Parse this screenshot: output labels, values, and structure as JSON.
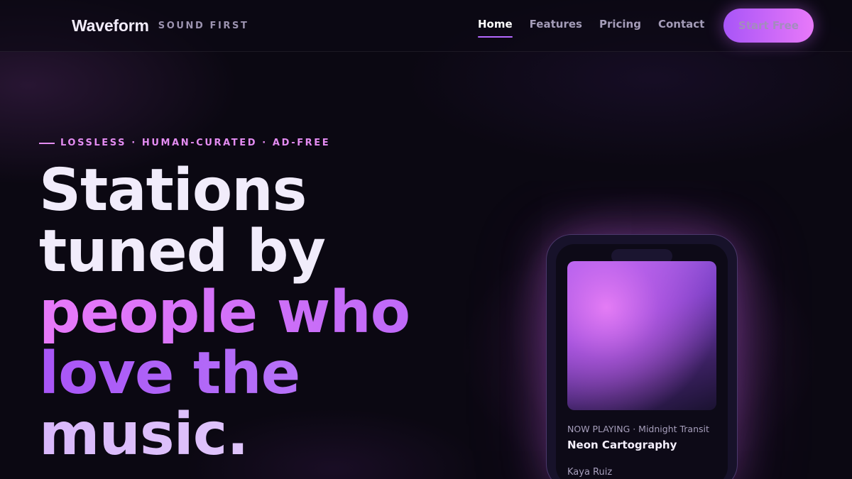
{
  "brand": {
    "name": "Waveform",
    "tagline": "SOUND FIRST",
    "icon": "waveform-icon"
  },
  "nav": {
    "items": [
      {
        "label": "Home",
        "active": true
      },
      {
        "label": "Features",
        "active": false
      },
      {
        "label": "Pricing",
        "active": false
      },
      {
        "label": "Contact",
        "active": false
      }
    ],
    "cta_label": "Start Free"
  },
  "hero": {
    "eyebrow": "LOSSLESS · HUMAN-CURATED · AD-FREE",
    "headline_lines": [
      "Stations",
      "tuned by",
      "people who",
      "love the",
      "music."
    ]
  },
  "player": {
    "now_playing": "NOW PLAYING · Midnight Transit",
    "track_title": "Neon Cartography",
    "artist": "Kaya Ruiz"
  },
  "colors": {
    "background": "#0b0812",
    "accent_purple": "#a855f7",
    "accent_pink": "#e879f9",
    "text_primary": "#f1ecfb",
    "text_muted": "#a49cb8"
  }
}
